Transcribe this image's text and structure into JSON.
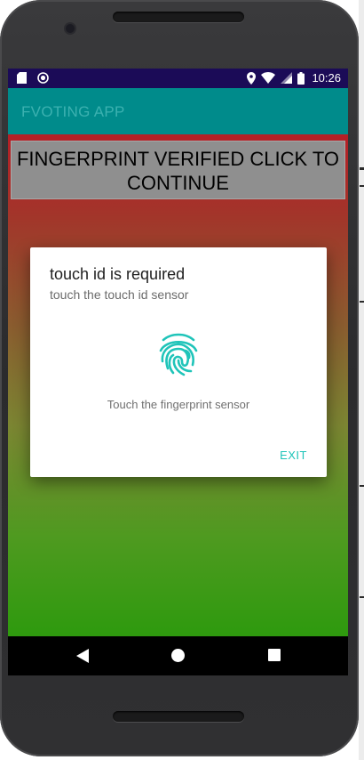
{
  "status_bar": {
    "time": "10:26",
    "left_icons": [
      "sd-card-icon",
      "record-icon"
    ],
    "right_icons": [
      "location-icon",
      "wifi-icon",
      "signal-icon",
      "battery-icon"
    ]
  },
  "app_bar": {
    "title": "FVOTING APP"
  },
  "main": {
    "verify_button_label": "FINGERPRINT VERIFIED CLICK TO CONTINUE"
  },
  "dialog": {
    "title": "touch id is required",
    "subtitle": "touch the touch id sensor",
    "icon": "fingerprint-icon",
    "hint": "Touch the fingerprint sensor",
    "exit_label": "EXIT",
    "accent_color": "#1fc4b9"
  },
  "nav_bar": {
    "buttons": [
      "back-icon",
      "home-icon",
      "recents-icon"
    ]
  },
  "colors": {
    "status_bar": "#1b0b57",
    "app_bar": "#008b8b",
    "gradient_top": "#b51f26",
    "gradient_bottom": "#2e9a0e"
  }
}
